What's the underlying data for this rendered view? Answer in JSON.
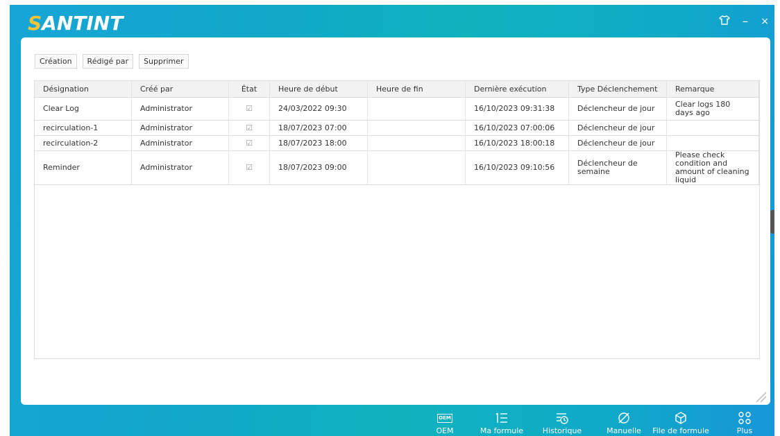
{
  "app": {
    "logo_pre": "S",
    "logo_rest": "ANTINT",
    "window_controls": {
      "skin_icon": "tshirt-icon",
      "minimize": "–",
      "close": "×"
    },
    "colors": {
      "accent": "#12a9c9",
      "logo_highlight": "#f3c43a"
    }
  },
  "toolbar": {
    "create_label": "Création",
    "edit_label": "Rédigé par",
    "delete_label": "Supprimer"
  },
  "table": {
    "headers": [
      "Désignation",
      "Créé par",
      "État",
      "Heure de début",
      "Heure de fin",
      "Dernière exécution",
      "Type Déclenchement",
      "Remarque"
    ],
    "rows": [
      {
        "name": "Clear Log",
        "creator": "Administrator",
        "state": "☑",
        "start": "24/03/2022 09:30",
        "end": "",
        "last": "16/10/2023 09:31:38",
        "type": "Déclencheur de jour",
        "remark": "Clear logs 180 days ago"
      },
      {
        "name": "recirculation-1",
        "creator": "Administrator",
        "state": "☑",
        "start": "18/07/2023 07:00",
        "end": "",
        "last": "16/10/2023 07:00:06",
        "type": "Déclencheur de jour",
        "remark": ""
      },
      {
        "name": "recirculation-2",
        "creator": "Administrator",
        "state": "☑",
        "start": "18/07/2023 18:00",
        "end": "",
        "last": "16/10/2023 18:00:18",
        "type": "Déclencheur de jour",
        "remark": ""
      },
      {
        "name": "Reminder",
        "creator": "Administrator",
        "state": "☑",
        "start": "18/07/2023 09:00",
        "end": "",
        "last": "16/10/2023 09:10:56",
        "type": "Déclencheur de semaine",
        "remark": "Please check condition and amount of cleaning liquid"
      }
    ]
  },
  "bottom_nav": {
    "items": [
      {
        "label": "OEM",
        "icon": "oem-icon",
        "badge": "OEM"
      },
      {
        "label": "Ma formule",
        "icon": "list-icon"
      },
      {
        "label": "Historique",
        "icon": "history-icon"
      },
      {
        "label": "Manuelle",
        "icon": "manual-icon"
      },
      {
        "label": "File de formule",
        "icon": "box-icon"
      },
      {
        "label": "Plus",
        "icon": "grid-icon"
      }
    ]
  }
}
